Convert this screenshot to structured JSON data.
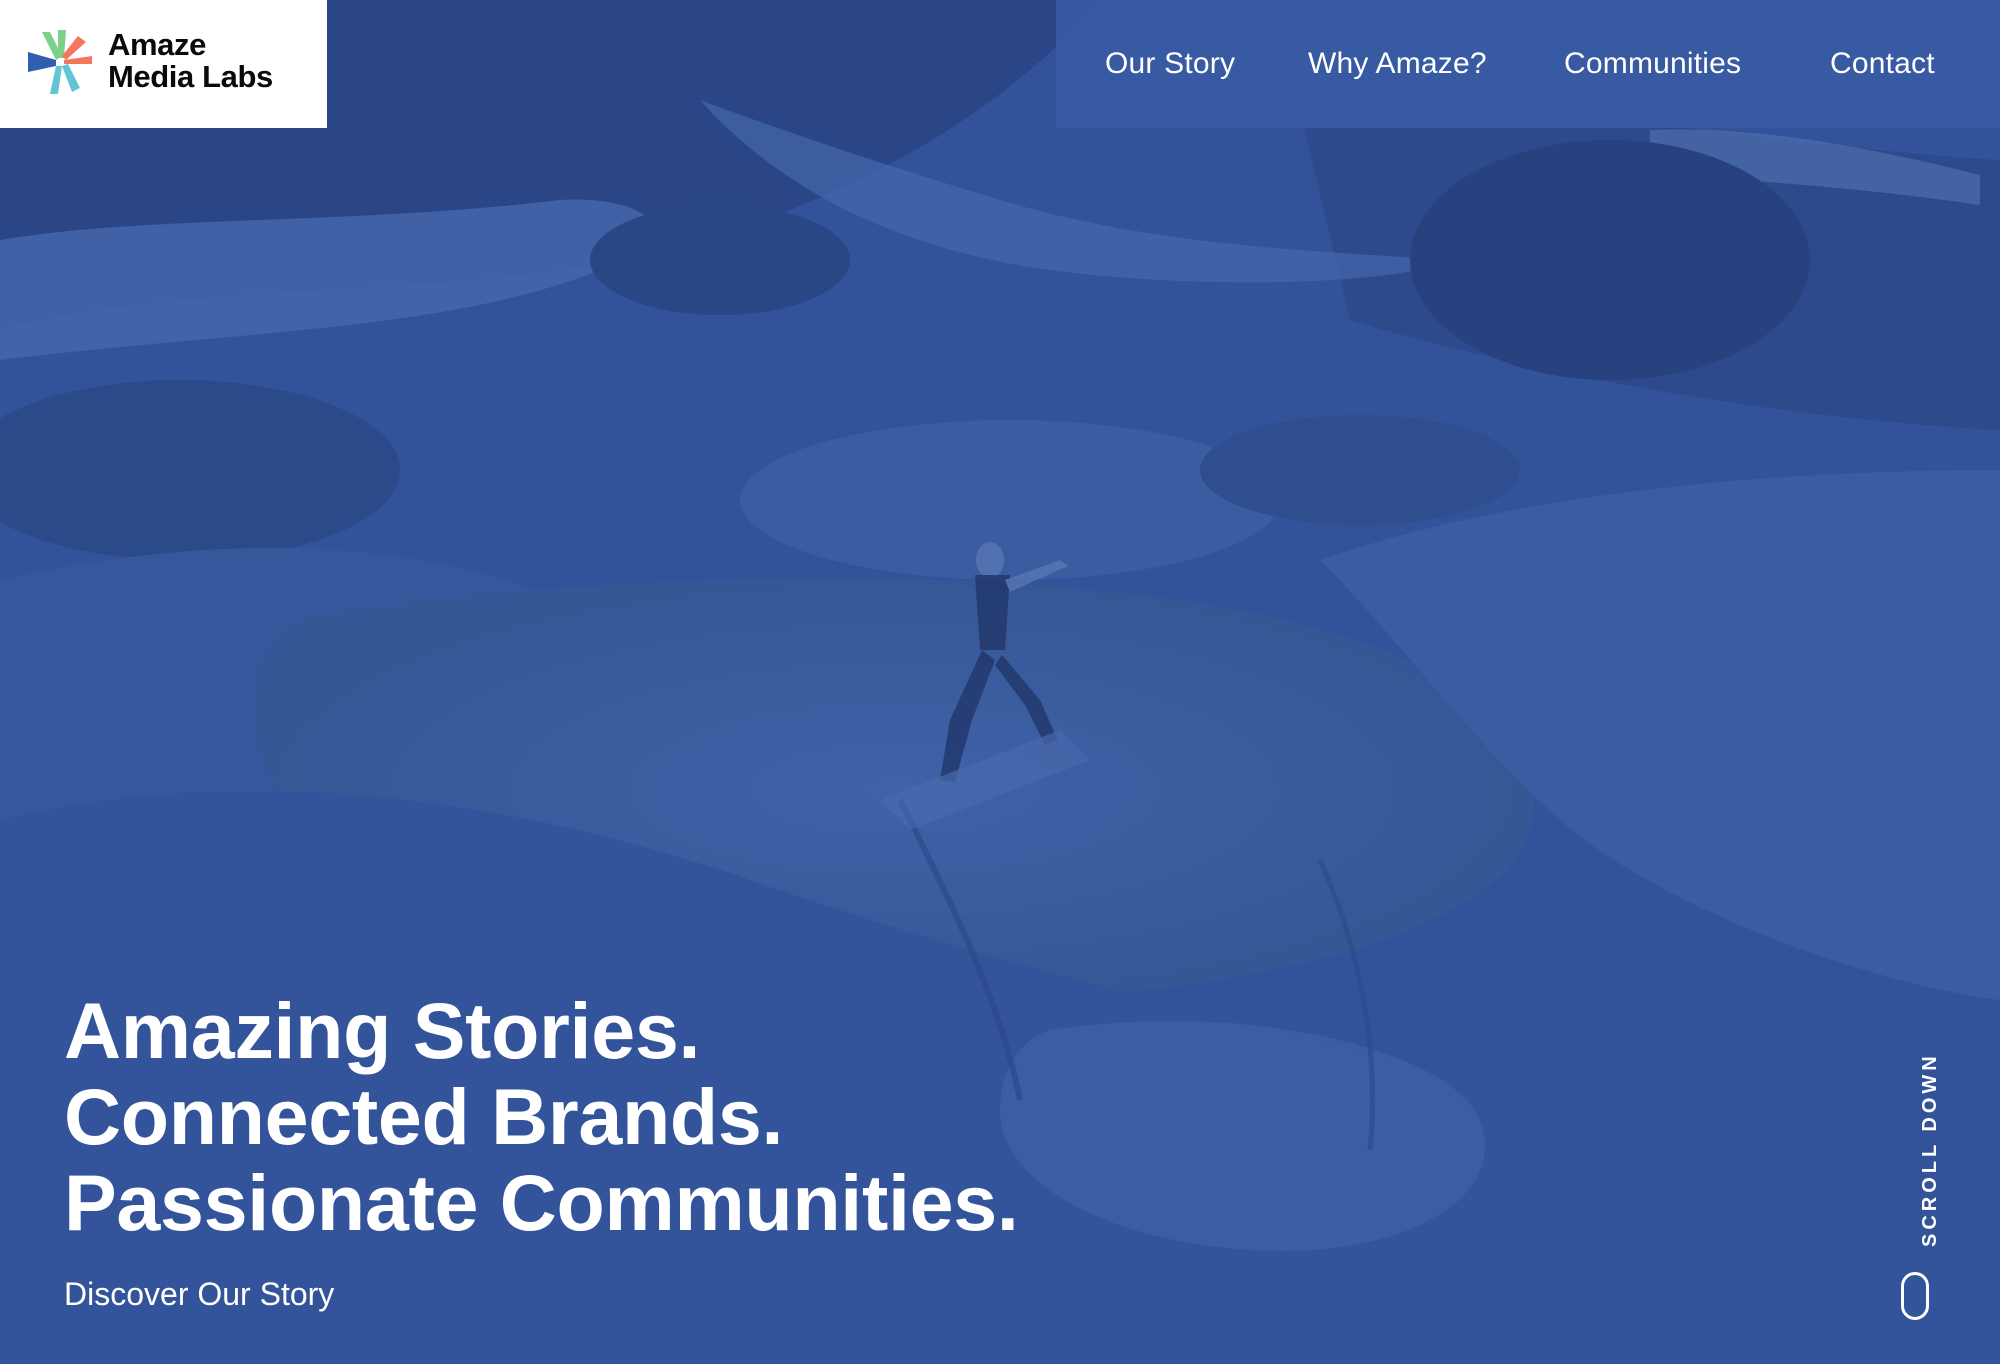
{
  "brand": {
    "name_line1": "Amaze",
    "name_line2": "Media Labs"
  },
  "nav": {
    "items": [
      {
        "label": "Our Story"
      },
      {
        "label": "Why Amaze?"
      },
      {
        "label": "Communities"
      },
      {
        "label": "Contact"
      }
    ]
  },
  "hero": {
    "headline": [
      "Amazing Stories.",
      "Connected Brands.",
      "Passionate Communities."
    ],
    "cta_label": "Discover Our Story",
    "scroll_label": "SCROLL DOWN",
    "overlay_color": "#2f4f92"
  },
  "colors": {
    "logo_green": "#7bd08a",
    "logo_orange": "#f2775c",
    "logo_blue": "#2f5fae",
    "logo_teal": "#63c4d3"
  }
}
